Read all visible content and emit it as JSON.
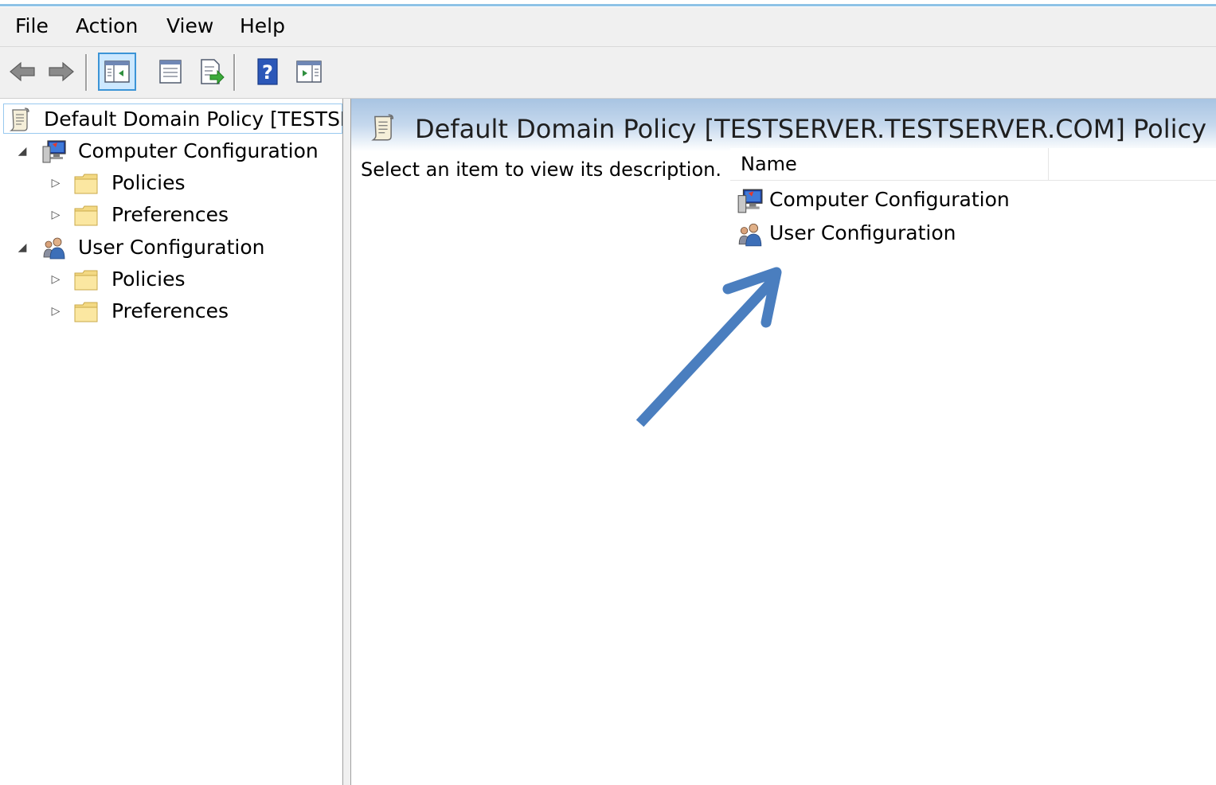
{
  "menubar": {
    "items": [
      {
        "label": "File"
      },
      {
        "label": "Action"
      },
      {
        "label": "View"
      },
      {
        "label": "Help"
      }
    ]
  },
  "toolbar": {
    "buttons": [
      {
        "icon": "back-arrow-icon"
      },
      {
        "icon": "forward-arrow-icon"
      },
      {
        "icon": "show-hide-console-tree-icon",
        "active": true
      },
      {
        "icon": "properties-icon"
      },
      {
        "icon": "export-list-icon"
      },
      {
        "icon": "help-icon"
      },
      {
        "icon": "show-hide-action-pane-icon"
      }
    ]
  },
  "tree": {
    "root": {
      "label": "Default Domain Policy [TESTSERVER.TESTSERVER.COM] Policy",
      "icon": "policy-scroll-icon"
    },
    "nodes": [
      {
        "label": "Computer Configuration",
        "icon": "computer-icon",
        "expander": "◢",
        "children": [
          {
            "label": "Policies",
            "icon": "folder-icon",
            "expander": "▷"
          },
          {
            "label": "Preferences",
            "icon": "folder-icon",
            "expander": "▷"
          }
        ]
      },
      {
        "label": "User Configuration",
        "icon": "users-icon",
        "expander": "◢",
        "children": [
          {
            "label": "Policies",
            "icon": "folder-icon",
            "expander": "▷"
          },
          {
            "label": "Preferences",
            "icon": "folder-icon",
            "expander": "▷"
          }
        ]
      }
    ]
  },
  "content": {
    "title": "Default Domain Policy [TESTSERVER.TESTSERVER.COM] Policy",
    "description": "Select an item to view its description.",
    "columns": [
      {
        "label": "Name"
      }
    ],
    "rows": [
      {
        "label": "Computer Configuration",
        "icon": "computer-icon"
      },
      {
        "label": "User Configuration",
        "icon": "users-icon"
      }
    ]
  },
  "colors": {
    "accent": "#8ec3e6",
    "header_gradient_top": "#a8c4e2",
    "arrow": "#4a7ebf",
    "selection_border": "#99c9ef"
  }
}
